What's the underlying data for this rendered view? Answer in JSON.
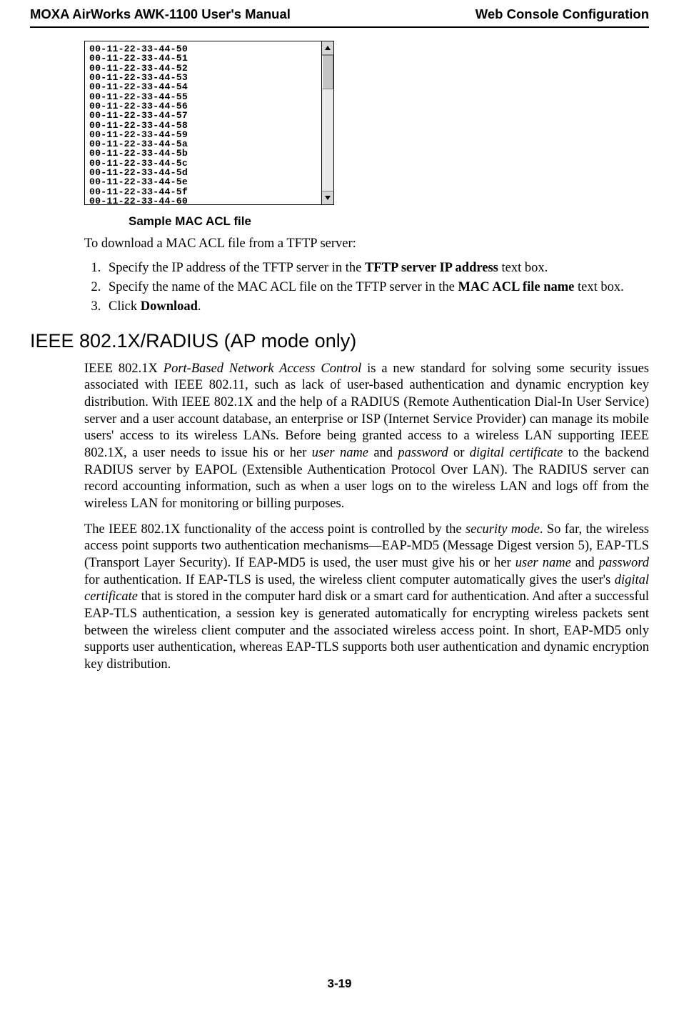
{
  "header": {
    "left": "MOXA AirWorks AWK-1100 User's Manual",
    "right": "Web Console Configuration"
  },
  "maclist": [
    "00-11-22-33-44-50",
    "00-11-22-33-44-51",
    "00-11-22-33-44-52",
    "00-11-22-33-44-53",
    "00-11-22-33-44-54",
    "00-11-22-33-44-55",
    "00-11-22-33-44-56",
    "00-11-22-33-44-57",
    "00-11-22-33-44-58",
    "00-11-22-33-44-59",
    "00-11-22-33-44-5a",
    "00-11-22-33-44-5b",
    "00-11-22-33-44-5c",
    "00-11-22-33-44-5d",
    "00-11-22-33-44-5e",
    "00-11-22-33-44-5f",
    "00-11-22-33-44-60"
  ],
  "caption": "Sample MAC ACL file",
  "intro": "To download a MAC ACL file from a TFTP server:",
  "steps": {
    "s1_a": "Specify the IP address of the TFTP server in the ",
    "s1_b": "TFTP server IP address",
    "s1_c": " text box.",
    "s2_a": "Specify the name of the MAC ACL file on the TFTP server in the ",
    "s2_b": "MAC ACL file name",
    "s2_c": " text box.",
    "s3_a": "Click ",
    "s3_b": "Download",
    "s3_c": "."
  },
  "section_heading": "IEEE 802.1X/RADIUS (AP mode only)",
  "para1": {
    "a": "IEEE 802.1X ",
    "b": "Port-Based Network Access Control",
    "c": " is a new standard for solving some security issues associated with IEEE 802.11, such as lack of user-based authentication and dynamic encryption key distribution. With IEEE 802.1X and the help of a RADIUS (Remote Authentication Dial-In User Service) server and a user account database, an enterprise or ISP (Internet Service Provider) can manage its mobile users' access to its wireless LANs. Before being granted access to a wireless LAN supporting IEEE 802.1X, a user needs to issue his or her ",
    "d": "user name",
    "e": " and ",
    "f": "password",
    "g": " or ",
    "h": "digital certificate",
    "i": " to the backend RADIUS server by EAPOL (Extensible Authentication Protocol Over LAN). The RADIUS server can record accounting information, such as when a user logs on to the wireless LAN and logs off from the wireless LAN for monitoring or billing purposes."
  },
  "para2": {
    "a": "The IEEE 802.1X functionality of the access point is controlled by the ",
    "b": "security mode",
    "c": ". So far, the wireless access point supports two authentication mechanisms—EAP-MD5 (Message Digest version 5), EAP-TLS (Transport Layer Security). If EAP-MD5 is used, the user must give his or her ",
    "d": "user name",
    "e": " and ",
    "f": "password",
    "g": " for authentication. If EAP-TLS is used, the wireless client computer automatically gives the user's ",
    "h": "digital certificate",
    "i": " that is stored in the computer hard disk or a smart card for authentication. And after a successful EAP-TLS authentication, a session key is generated automatically for encrypting wireless packets sent between the wireless client computer and the associated wireless access point. In short, EAP-MD5 only supports user authentication, whereas EAP-TLS supports both user authentication and dynamic encryption key distribution."
  },
  "page_number": "3-19"
}
